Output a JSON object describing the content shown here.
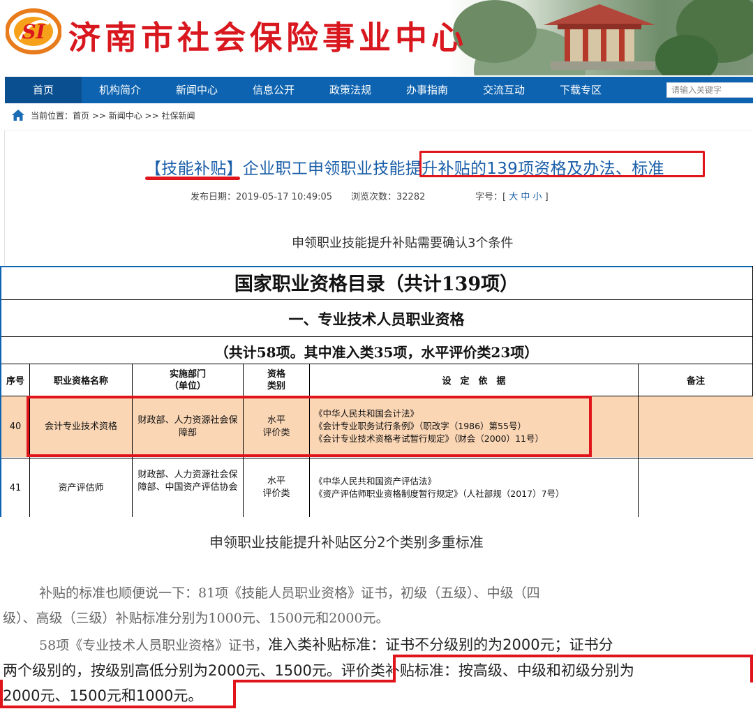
{
  "site": {
    "title": "济南市社会保险事业中心",
    "logo_text": "SI"
  },
  "nav": {
    "items": [
      "首页",
      "机构简介",
      "新闻中心",
      "信息公开",
      "政策法规",
      "办事指南",
      "交流互动",
      "下载专区"
    ],
    "search_placeholder": "请输入关键字"
  },
  "breadcrumb": {
    "text": "当前位置：首页 >> 新闻中心 >> 社保新闻"
  },
  "article": {
    "title_tag": "【技能补贴】",
    "title_rest": "企业职工申领职业技能提升补贴的139项资格及办法、标准",
    "publish_date": "发布日期：2019-05-17 10:49:05",
    "views": "浏览次数：32282",
    "font_size_label": "字号：[",
    "font_size_options": "大 中 小",
    "font_size_close": "]",
    "subheading1": "申领职业技能提升补贴需要确认3个条件",
    "subheading2": "申领职业技能提升补贴区分2个类别多重标准"
  },
  "table": {
    "title": "国家职业资格目录（共计139项）",
    "section": "一、专业技术人员职业资格",
    "summary": "（共计58项。其中准入类35项，水平评价类23项）",
    "headers": {
      "no": "序号",
      "name": "职业资格名称",
      "dept": "实施部门",
      "dept_sub": "（单位）",
      "cat": "资格",
      "cat_sub": "类别",
      "basis": "设　定　依　据",
      "note": "备注"
    },
    "rows": [
      {
        "no": "40",
        "name": "会计专业技术资格",
        "dept": "财政部、人力资源社会保障部",
        "cat1": "水平",
        "cat2": "评价类",
        "basis1": "《中华人民共和国会计法》",
        "basis2": "《会计专业职务试行条例》（职改字（1986）第55号）",
        "basis3": "《会计专业技术资格考试暂行规定》（财会（2000）11号）"
      },
      {
        "no": "41",
        "name": "资产评估师",
        "dept": "财政部、人力资源社会保障部、中国资产评估协会",
        "cat1": "水平",
        "cat2": "评价类",
        "basis1": "《中华人民共和国资产评估法》",
        "basis2": "《资产评估师职业资格制度暂行规定》（人社部规（2017）7号）"
      }
    ]
  },
  "body_text": {
    "line1": "补贴的标准也顺便说一下：81项《技能人员职业资格》证书，初级（五级）、中级（四",
    "line2": "级）、高级（三级）补贴标准分别为1000元、1500元和2000元。",
    "line3_serif": "58项《专业技术人员职业资格》证书，",
    "line3_rest": "准入类补贴标准：证书不分级别的为2000元；证书分",
    "line4": "两个级别的，按级别高低分别为2000元、1500元。评价类补贴标准：按高级、中级和初级分别为",
    "line5": "2000元、1500元和1000元。"
  },
  "colors": {
    "brand_red": "#d8171e",
    "nav_blue": "#0d63b0",
    "title_blue": "#1a5ea8",
    "highlight_row": "#fbd6b5",
    "annotation_red": "#e0151c"
  }
}
